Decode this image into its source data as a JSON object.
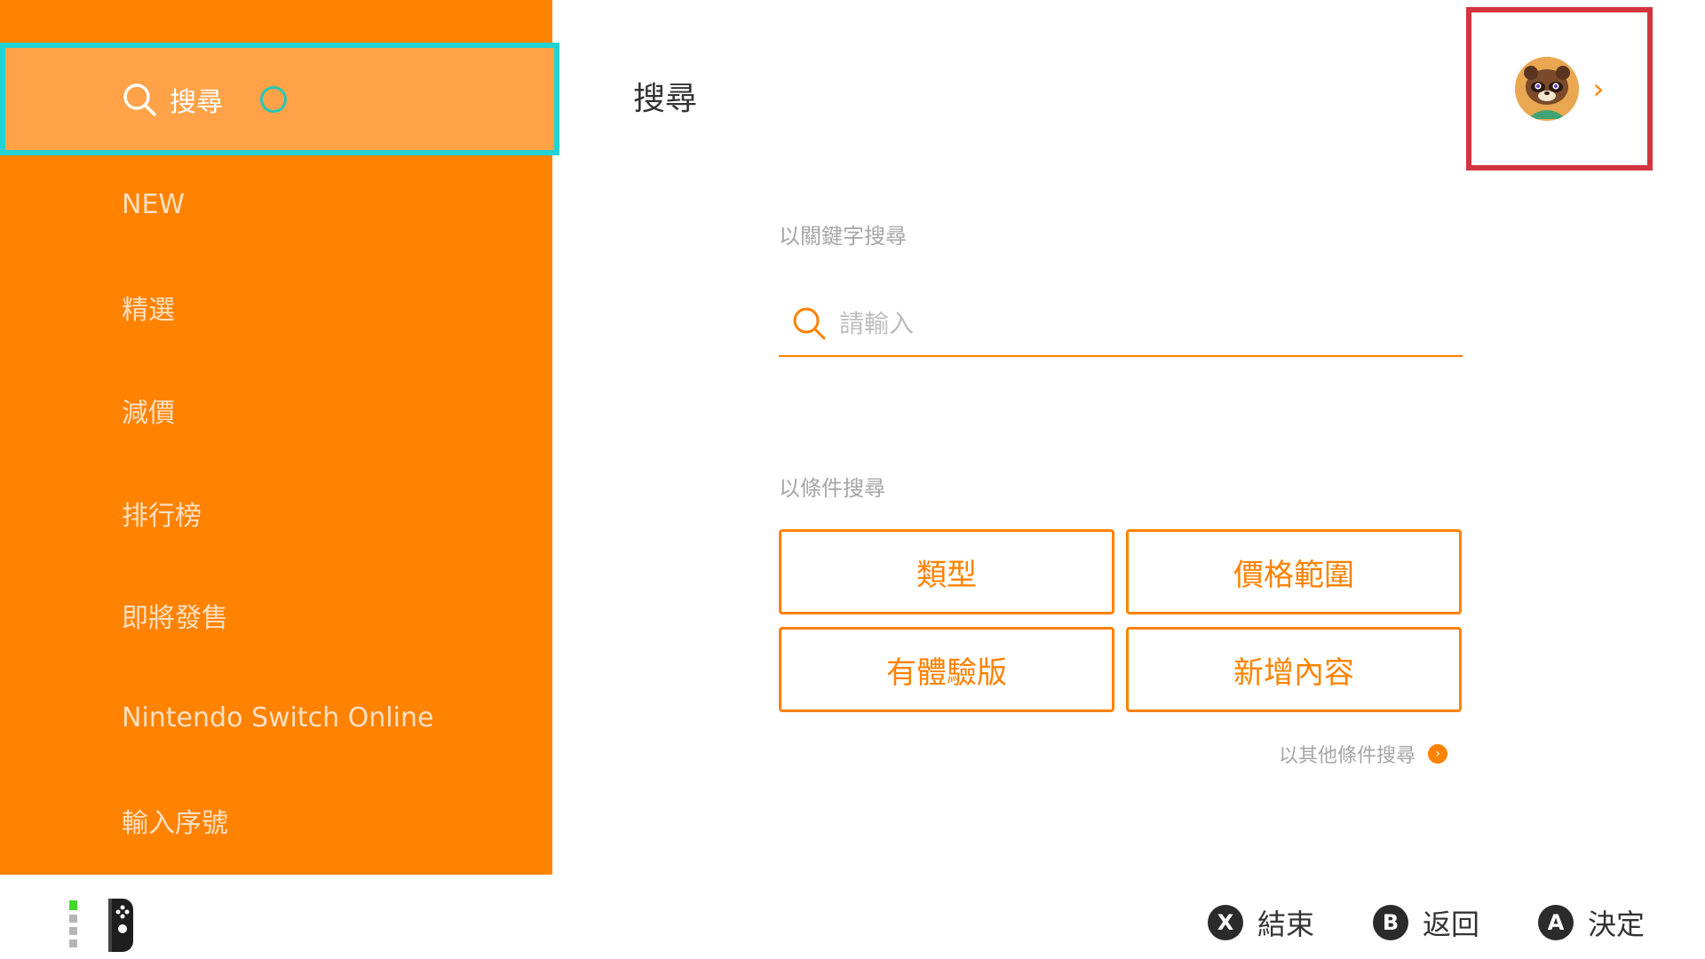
{
  "sidebar": {
    "selected": "搜尋",
    "items": [
      {
        "label": "NEW"
      },
      {
        "label": "精選"
      },
      {
        "label": "減價"
      },
      {
        "label": "排行榜"
      },
      {
        "label": "即將發售"
      },
      {
        "label": "Nintendo Switch Online"
      },
      {
        "label": "輸入序號"
      }
    ]
  },
  "main": {
    "title": "搜尋",
    "keyword_section_label": "以關鍵字搜尋",
    "search_placeholder": "請輸入",
    "condition_section_label": "以條件搜尋",
    "filters": [
      "類型",
      "價格範圍",
      "有體驗版",
      "新增內容"
    ],
    "more_link": "以其他條件搜尋"
  },
  "footer": {
    "hints": [
      {
        "button": "X",
        "label": "結束"
      },
      {
        "button": "B",
        "label": "返回"
      },
      {
        "button": "A",
        "label": "決定"
      }
    ]
  },
  "colors": {
    "accent": "#ff8200",
    "selected_border": "#22d3d3",
    "user_box_border": "#d3343f"
  },
  "icons": {
    "search": "search-icon",
    "avatar": "user-avatar",
    "chevron": "chevron-right-icon",
    "controller": "joy-con-icon"
  }
}
